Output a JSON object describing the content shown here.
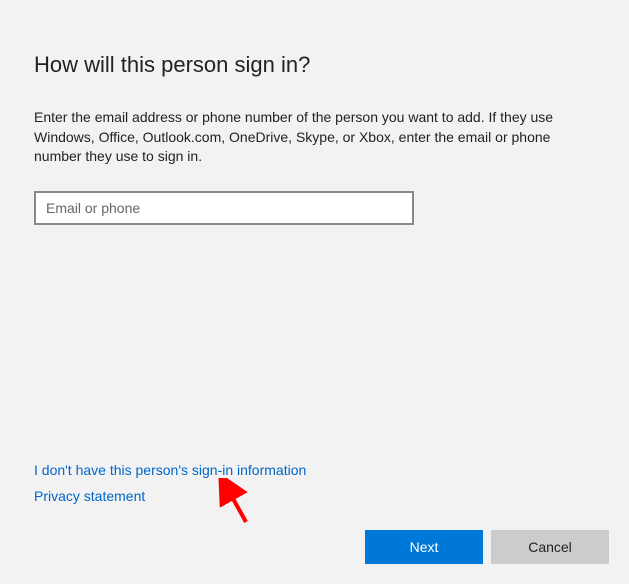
{
  "title": "How will this person sign in?",
  "description": "Enter the email address or phone number of the person you want to add. If they use Windows, Office, Outlook.com, OneDrive, Skype, or Xbox, enter the email or phone number they use to sign in.",
  "input": {
    "placeholder": "Email or phone",
    "value": ""
  },
  "links": {
    "no_signin_info": "I don't have this person's sign-in information",
    "privacy": "Privacy statement"
  },
  "buttons": {
    "next": "Next",
    "cancel": "Cancel"
  }
}
